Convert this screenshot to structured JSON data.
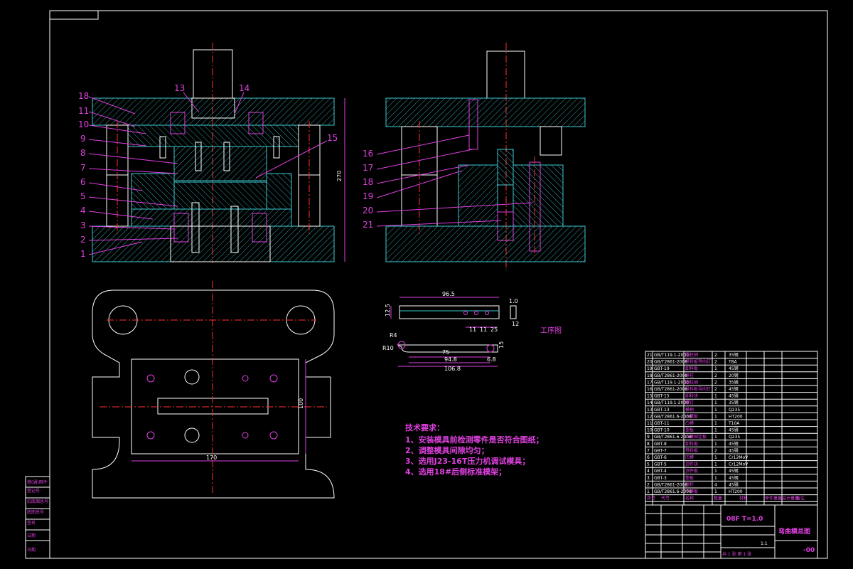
{
  "part_labels_left": [
    "18",
    "11",
    "10",
    "9",
    "8",
    "7",
    "6",
    "5",
    "4",
    "3",
    "2",
    "1"
  ],
  "part_labels_top": [
    "13",
    "14",
    "15"
  ],
  "part_labels_right": [
    "16",
    "17",
    "18",
    "19",
    "20",
    "21"
  ],
  "process_title": "工序图",
  "dims": {
    "strip_len": "96.5",
    "strip_sub": [
      "11",
      "11",
      "25"
    ],
    "strip_h": "12.5",
    "thk": "1.0",
    "w_side": "12",
    "bent_total": "106.8",
    "bent_inner": "94.8",
    "bent_mid": "75",
    "bent_end": "6.8",
    "bent_h": "15",
    "bent_a": "R4",
    "bent_b": "R10",
    "plan_w": "170",
    "plan_h": "100",
    "overall_h": "270"
  },
  "tech": {
    "title": "技术要求：",
    "items": [
      "1、安装模具前检测零件是否符合图纸；",
      "2、调整模具间隙均匀；",
      "3、选用J23-16T压力机调试模具；",
      "4、选用18#后侧标准模架；"
    ]
  },
  "bom": {
    "header": [
      "序号",
      "代号",
      "名称",
      "数量",
      "材料",
      "单件重量",
      "总计重量",
      "备注"
    ],
    "rows": [
      [
        "21",
        "GB/T119.1-2000",
        "圆柱销",
        "2",
        "35钢",
        ""
      ],
      [
        "20",
        "GB/T2861-2008",
        "导料板导向钉",
        "2",
        "T8A",
        ""
      ],
      [
        "19",
        "GBT-19",
        "卸料板",
        "1",
        "45钢",
        ""
      ],
      [
        "18",
        "GB/T2861-2008",
        "导柱",
        "2",
        "20钢",
        ""
      ],
      [
        "17",
        "GB/T119.1-2000",
        "圆柱销",
        "2",
        "35钢",
        ""
      ],
      [
        "16",
        "GB/T2861-2008",
        "导料板导向钉",
        "2",
        "45钢",
        ""
      ],
      [
        "15",
        "GBT-15",
        "卸料块",
        "1",
        "45钢",
        ""
      ],
      [
        "14",
        "GB/T119.1-2000",
        "螺钉",
        "1",
        "35钢",
        ""
      ],
      [
        "13",
        "GBT-13",
        "模柄",
        "1",
        "Q235",
        ""
      ],
      [
        "12",
        "GB/T2861.6-2008",
        "上模板",
        "1",
        "HT200",
        ""
      ],
      [
        "11",
        "GBT-11",
        "凸模",
        "1",
        "T10A",
        ""
      ],
      [
        "10",
        "GBT-10",
        "垫板",
        "1",
        "45钢",
        ""
      ],
      [
        "9",
        "GB/T2861.6-2008",
        "凸模固定板",
        "1",
        "Q235",
        ""
      ],
      [
        "8",
        "GBT-8",
        "卸料板",
        "1",
        "45钢",
        ""
      ],
      [
        "7",
        "GBT-7",
        "导料板",
        "2",
        "45钢",
        ""
      ],
      [
        "6",
        "GBT-6",
        "凹模",
        "1",
        "Cr12MoV",
        ""
      ],
      [
        "5",
        "GBT-5",
        "顶件块",
        "1",
        "Cr12MoV",
        ""
      ],
      [
        "4",
        "GBT-4",
        "顶件板",
        "1",
        "45钢",
        ""
      ],
      [
        "3",
        "GBT-3",
        "垫板",
        "1",
        "45钢",
        ""
      ],
      [
        "2",
        "GB/T2861-2008",
        "顶杆",
        "4",
        "45钢",
        ""
      ],
      [
        "1",
        "GB/T2861.6-2008",
        "下模板",
        "1",
        "HT200",
        ""
      ]
    ]
  },
  "titleblock": {
    "material": "08F  T=1.0",
    "drawing_name": "弯曲模总图",
    "code": "-00",
    "scale": "1:1",
    "sheet": "共 1 张 第 1 张"
  },
  "margin_stamp": [
    "借(通)用件",
    "登记号",
    "旧底图总号",
    "底图总号",
    "签名",
    "日期",
    "日期"
  ],
  "colors": {
    "background": "#000000",
    "frame": "#e040e0",
    "outline": "#ffffff",
    "section": "#3ec9d0",
    "center": "#ff3030"
  }
}
